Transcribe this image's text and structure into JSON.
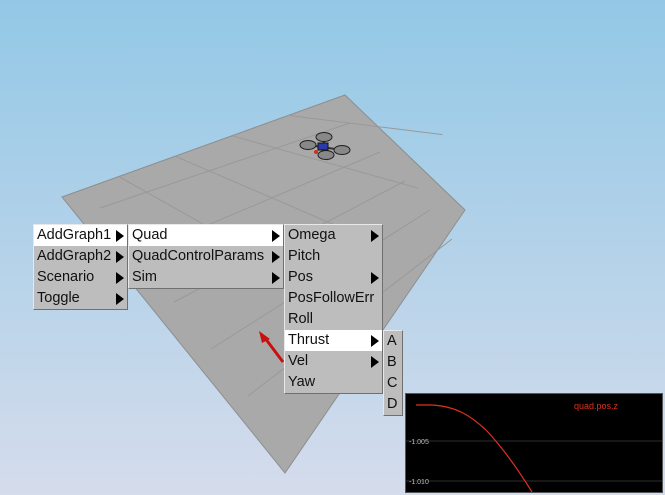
{
  "menu_level1": [
    {
      "label": "AddGraph1",
      "submenu": true,
      "highlighted": true
    },
    {
      "label": "AddGraph2",
      "submenu": true,
      "highlighted": false
    },
    {
      "label": "Scenario",
      "submenu": true,
      "highlighted": false
    },
    {
      "label": "Toggle",
      "submenu": true,
      "highlighted": false
    }
  ],
  "menu_level2": [
    {
      "label": "Quad",
      "submenu": true,
      "highlighted": true
    },
    {
      "label": "QuadControlParams",
      "submenu": true,
      "highlighted": false
    },
    {
      "label": "Sim",
      "submenu": true,
      "highlighted": false
    }
  ],
  "menu_level3": [
    {
      "label": "Omega",
      "submenu": true,
      "highlighted": false
    },
    {
      "label": "Pitch",
      "submenu": false,
      "highlighted": false
    },
    {
      "label": "Pos",
      "submenu": true,
      "highlighted": false
    },
    {
      "label": "PosFollowErr",
      "submenu": false,
      "highlighted": false
    },
    {
      "label": "Roll",
      "submenu": false,
      "highlighted": false
    },
    {
      "label": "Thrust",
      "submenu": true,
      "highlighted": true
    },
    {
      "label": "Vel",
      "submenu": true,
      "highlighted": false
    },
    {
      "label": "Yaw",
      "submenu": false,
      "highlighted": false
    }
  ],
  "menu_level4": [
    {
      "label": "A",
      "submenu": false,
      "highlighted": false
    },
    {
      "label": "B",
      "submenu": false,
      "highlighted": false
    },
    {
      "label": "C",
      "submenu": false,
      "highlighted": false
    },
    {
      "label": "D",
      "submenu": false,
      "highlighted": false
    }
  ],
  "graph": {
    "legend": "quad.pos.z",
    "ytick_1": "-1.005",
    "ytick_2": "-1.010",
    "series": [
      {
        "name": "quad.pos.z",
        "color": "#e0301e"
      }
    ]
  },
  "colors": {
    "sky_top": "#92c8e6",
    "sky_bottom": "#d5dcec",
    "ground": "#a9a9a9",
    "menu_bg": "#bdbdbd",
    "menu_highlight": "#ffffff",
    "graph_bg": "#000000",
    "graph_line": "#e0301e"
  }
}
